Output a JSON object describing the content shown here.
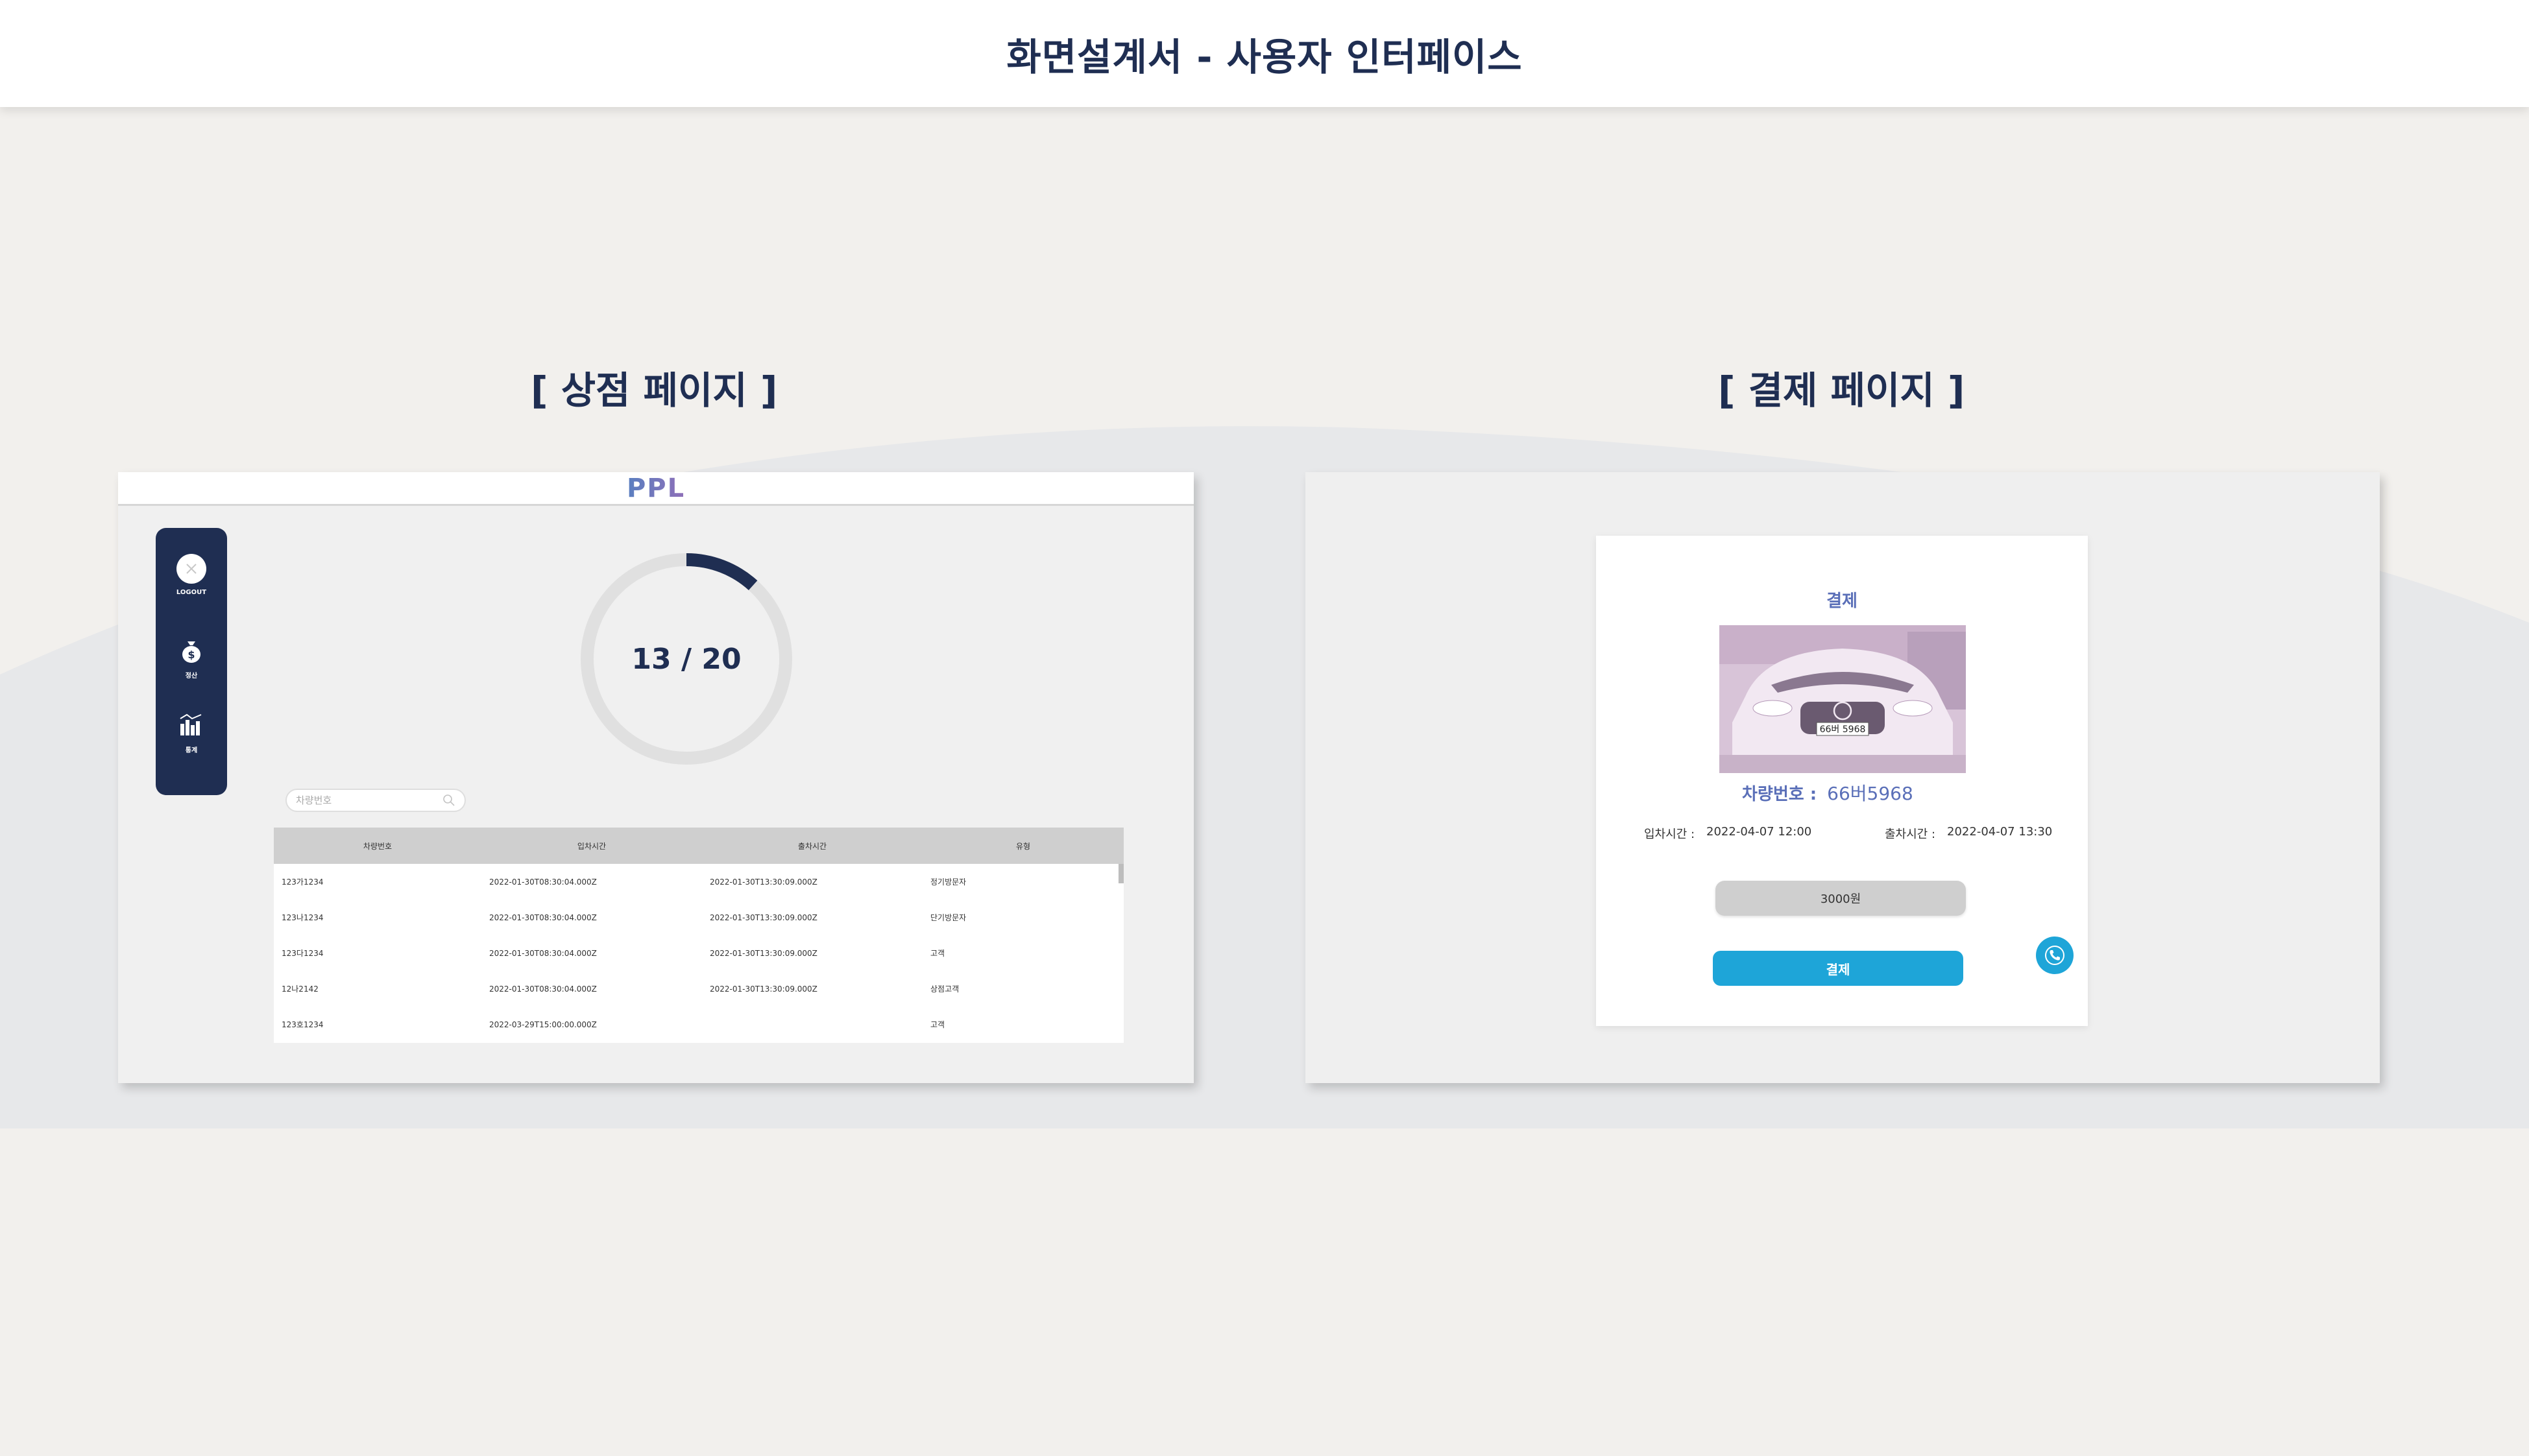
{
  "header": {
    "title": "화면설계서 - 사용자 인터페이스"
  },
  "sections": {
    "shop_title": "[ 상점 페이지 ]",
    "payment_title": "[ 결제 페이지 ]"
  },
  "shop": {
    "logo": "PPL",
    "sidebar": [
      {
        "label": "LOGOUT",
        "icon": "logout-icon"
      },
      {
        "label": "정산",
        "icon": "money-bag-icon"
      },
      {
        "label": "통계",
        "icon": "bar-chart-icon"
      }
    ],
    "occupancy": {
      "current": 13,
      "total": 20,
      "text": "13 / 20"
    },
    "search": {
      "placeholder": "차량번호"
    },
    "table": {
      "headers": [
        "차량번호",
        "입차시간",
        "출차시간",
        "유형"
      ],
      "rows": [
        [
          "123가1234",
          "2022-01-30T08:30:04.000Z",
          "2022-01-30T13:30:09.000Z",
          "정기방문자"
        ],
        [
          "123나1234",
          "2022-01-30T08:30:04.000Z",
          "2022-01-30T13:30:09.000Z",
          "단기방문자"
        ],
        [
          "123다1234",
          "2022-01-30T08:30:04.000Z",
          "2022-01-30T13:30:09.000Z",
          "고객"
        ],
        [
          "12나2142",
          "2022-01-30T08:30:04.000Z",
          "2022-01-30T13:30:09.000Z",
          "상점고객"
        ],
        [
          "123호1234",
          "2022-03-29T15:00:00.000Z",
          "",
          "고객"
        ]
      ]
    }
  },
  "payment": {
    "title": "결제",
    "car_number_label": "차량번호 :",
    "car_number": "66버5968",
    "plate_text": "66버 5968",
    "entry_label": "입차시간 :",
    "entry_time": "2022-04-07 12:00",
    "exit_label": "출차시간 :",
    "exit_time": "2022-04-07 13:30",
    "amount": "3000원",
    "pay_button": "결제"
  },
  "colors": {
    "navy": "#1f2e52",
    "accent_blue": "#1ea5d8",
    "title_blue": "#5a6fb8",
    "donut_track": "#e0e0e0"
  }
}
